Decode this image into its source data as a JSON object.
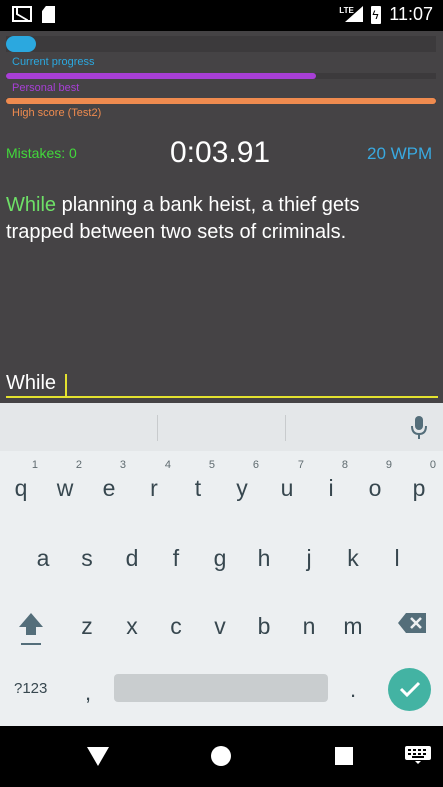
{
  "status_bar": {
    "network": "LTE",
    "time": "11:07"
  },
  "progress": {
    "current": {
      "label": "Current progress",
      "fraction": 0.07,
      "color": "#2ba8df"
    },
    "personal_best": {
      "label": "Personal best",
      "fraction": 0.72,
      "color": "#a83fd6"
    },
    "high_score": {
      "label": "High score (Test2)",
      "fraction": 1.0,
      "color": "#ef8b4f"
    }
  },
  "stats": {
    "mistakes": "Mistakes: 0",
    "timer": "0:03.91",
    "wpm": "20 WPM"
  },
  "sentence": {
    "typed": "While",
    "remaining": " planning a bank heist, a thief gets trapped between two sets of criminals."
  },
  "input": {
    "value": "While"
  },
  "keyboard": {
    "row1": [
      {
        "ch": "q",
        "hint": "1"
      },
      {
        "ch": "w",
        "hint": "2"
      },
      {
        "ch": "e",
        "hint": "3"
      },
      {
        "ch": "r",
        "hint": "4"
      },
      {
        "ch": "t",
        "hint": "5"
      },
      {
        "ch": "y",
        "hint": "6"
      },
      {
        "ch": "u",
        "hint": "7"
      },
      {
        "ch": "i",
        "hint": "8"
      },
      {
        "ch": "o",
        "hint": "9"
      },
      {
        "ch": "p",
        "hint": "0"
      }
    ],
    "row2": [
      "a",
      "s",
      "d",
      "f",
      "g",
      "h",
      "j",
      "k",
      "l"
    ],
    "row3": [
      "z",
      "x",
      "c",
      "v",
      "b",
      "n",
      "m"
    ],
    "symbols_label": "?123",
    "comma": ",",
    "period": "."
  }
}
